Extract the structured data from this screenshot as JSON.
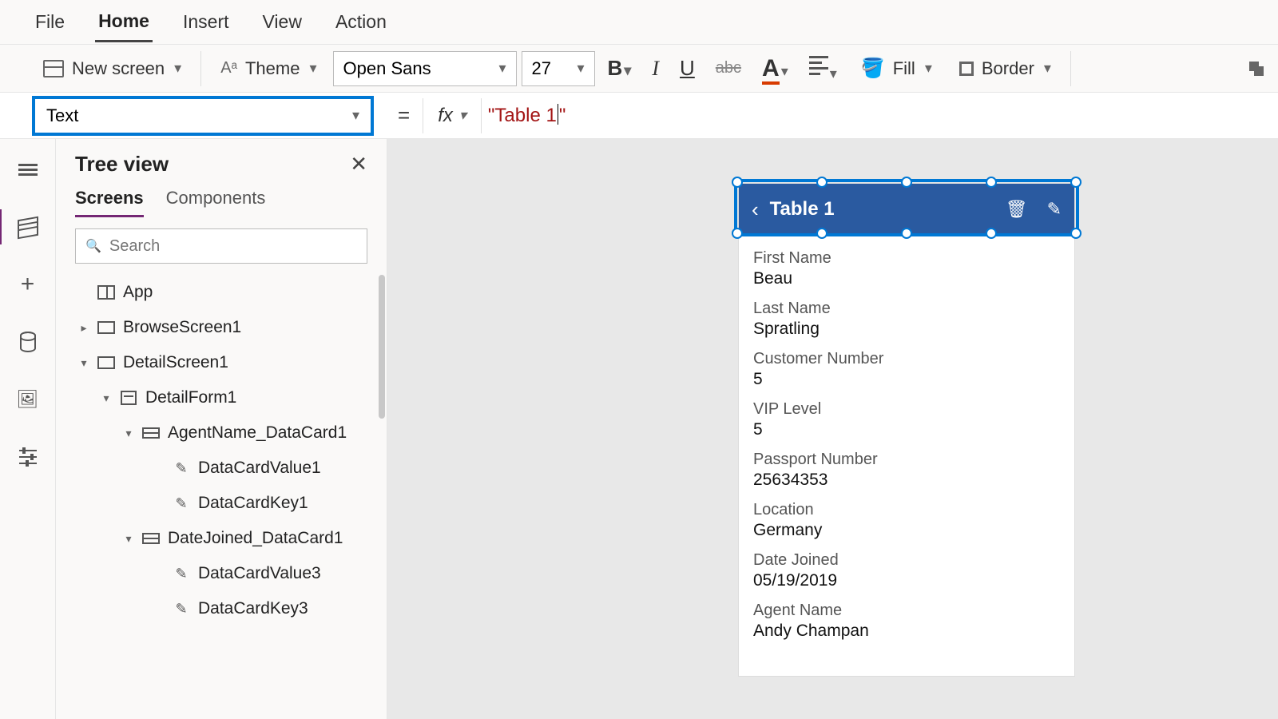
{
  "menu": {
    "file": "File",
    "home": "Home",
    "insert": "Insert",
    "view": "View",
    "action": "Action"
  },
  "ribbon": {
    "new_screen": "New screen",
    "theme": "Theme",
    "font": "Open Sans",
    "font_size": "27",
    "fill": "Fill",
    "border": "Border"
  },
  "formula": {
    "property": "Text",
    "fx": "fx",
    "value_open": "\"Table 1",
    "value_close": "\""
  },
  "panel": {
    "title": "Tree view",
    "tabs": {
      "screens": "Screens",
      "components": "Components"
    },
    "search_placeholder": "Search"
  },
  "tree": {
    "app": "App",
    "browse": "BrowseScreen1",
    "detail": "DetailScreen1",
    "form": "DetailForm1",
    "card1": "AgentName_DataCard1",
    "dcv1": "DataCardValue1",
    "dck1": "DataCardKey1",
    "card2": "DateJoined_DataCard1",
    "dcv3": "DataCardValue3",
    "dck3": "DataCardKey3"
  },
  "preview": {
    "title": "Table 1",
    "fields": [
      {
        "label": "First Name",
        "value": "Beau"
      },
      {
        "label": "Last Name",
        "value": "Spratling"
      },
      {
        "label": "Customer Number",
        "value": "5"
      },
      {
        "label": "VIP Level",
        "value": "5"
      },
      {
        "label": "Passport Number",
        "value": "25634353"
      },
      {
        "label": "Location",
        "value": "Germany"
      },
      {
        "label": "Date Joined",
        "value": "05/19/2019"
      },
      {
        "label": "Agent Name",
        "value": "Andy Champan"
      }
    ]
  }
}
